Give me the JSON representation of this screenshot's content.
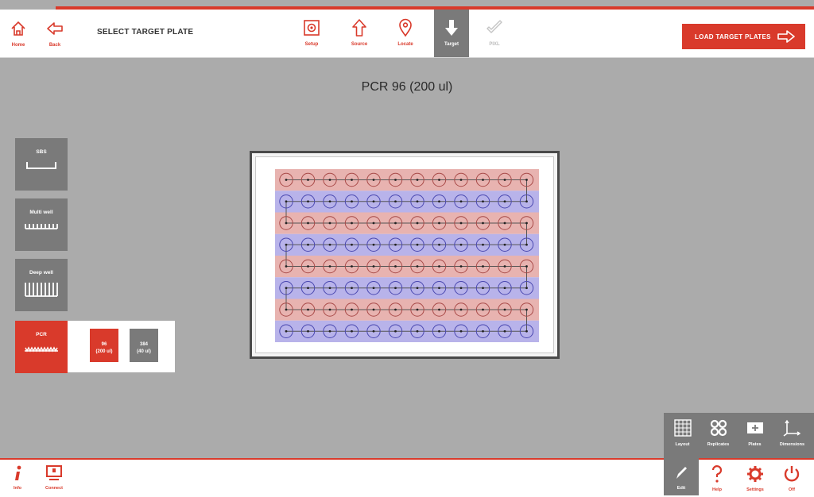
{
  "header": {
    "home_label": "Home",
    "back_label": "Back",
    "page_title": "SELECT TARGET PLATE",
    "steps": [
      {
        "label": "Setup"
      },
      {
        "label": "Source"
      },
      {
        "label": "Locate"
      },
      {
        "label": "Target"
      },
      {
        "label": "PIXL"
      }
    ],
    "load_button": "LOAD TARGET PLATES"
  },
  "plate": {
    "title": "PCR 96 (200 ul)",
    "rows": 8,
    "columns": 12,
    "colors": {
      "row_red": "#e8b3b0",
      "row_blue": "#b8b3ea",
      "well_red": "#a84a48",
      "well_blue": "#4a48b0",
      "line": "#555555"
    }
  },
  "plate_types": [
    {
      "label": "SBS"
    },
    {
      "label": "Multi well"
    },
    {
      "label": "Deep well"
    },
    {
      "label": "PCR"
    }
  ],
  "pcr_options": [
    {
      "line1": "96",
      "line2": "(200 ul)"
    },
    {
      "line1": "384",
      "line2": "(40 ul)"
    }
  ],
  "tools": [
    {
      "label": "Layout",
      "icon": "grid-icon"
    },
    {
      "label": "Replicates",
      "icon": "replicates-icon"
    },
    {
      "label": "Plates",
      "icon": "plates-icon"
    },
    {
      "label": "Dimensions",
      "icon": "axes-icon"
    }
  ],
  "footer": {
    "info_label": "Info",
    "connect_label": "Connect",
    "edit_label": "Edit",
    "help_label": "Help",
    "settings_label": "Settings",
    "off_label": "Off"
  },
  "colors": {
    "accent": "#d93a2b",
    "panel_gray": "#7a7a7a",
    "background": "#ababab"
  }
}
